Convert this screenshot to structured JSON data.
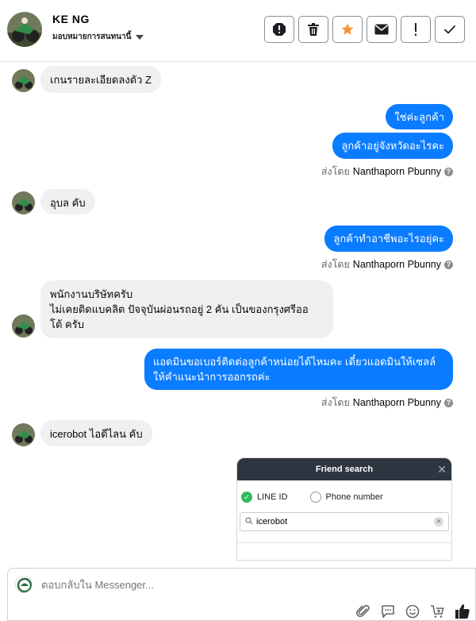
{
  "header": {
    "name": "KE NG",
    "assign_label": "มอบหมายการสนทนานี้",
    "tools": [
      {
        "icon": "alert-icon",
        "label": "Mark as spam"
      },
      {
        "icon": "trash-icon",
        "label": "Delete"
      },
      {
        "icon": "star-icon",
        "label": "Star"
      },
      {
        "icon": "mail-icon",
        "label": "Mark as unread"
      },
      {
        "icon": "exclamation-icon",
        "label": "Follow up"
      },
      {
        "icon": "check-icon",
        "label": "Mark as done"
      }
    ]
  },
  "messages": {
    "m1": "เกนรายละเอียดลงตัว Z",
    "m2": "ใช่ค่ะลูกค้า",
    "m3": "ลูกค้าอยู่จังหวัดอะไรคะ",
    "m4": "อุบล คับ",
    "m5": "ลูกค้าทำอาชีพอะไรอยุ่คะ",
    "m6": "พนักงานบริษัทครับ\nไม่เคยติดแบคลิต ปัจจุบันผ่อนรถอยู่ 2 คัน เป็นของกรุงศรีออ\nโต้ ครับ",
    "m7": "แอดมินขอเบอร์ติดต่อลูกค้าหน่อยได้ไหมคะ เดี๋ยวแอดมินให้เซลล์\nให้คำแนะนำการออกรถค่ะ",
    "m8": "icerobot ไอดีไลน คับ"
  },
  "sent_by": {
    "prefix": "ส่งโดย",
    "agent": "Nanthaporn Pbunny",
    "info_icon": "?"
  },
  "shared_screenshot": {
    "title": "Friend search",
    "close_glyph": "✕",
    "option_line_id": "LINE ID",
    "option_phone": "Phone number",
    "search_value": "icerobot"
  },
  "composer": {
    "placeholder": "ตอบกลับใน Messenger..."
  },
  "colors": {
    "outgoing_bubble": "#0a7cff",
    "incoming_bubble": "#f0f0f0",
    "star": "#f7923a",
    "line_green": "#2fbb5a"
  }
}
